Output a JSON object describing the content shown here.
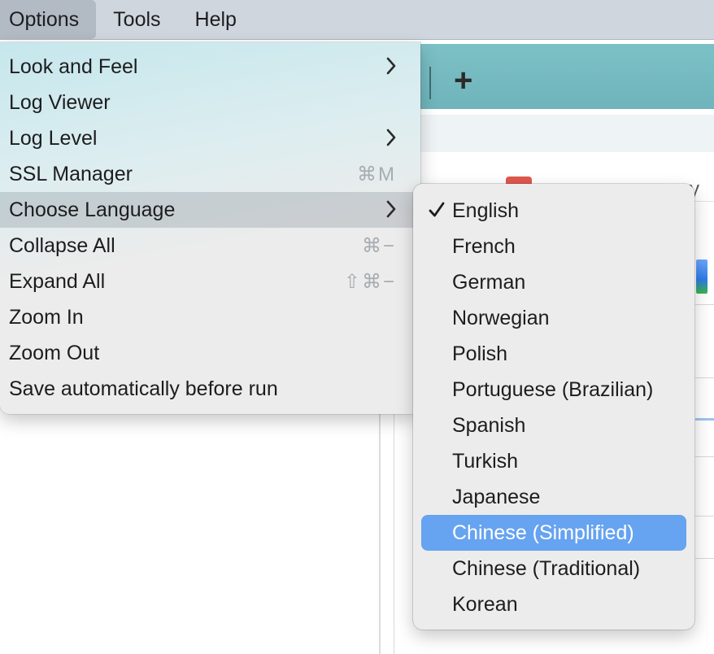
{
  "menubar": {
    "items": [
      {
        "label": "Options",
        "active": true
      },
      {
        "label": "Tools",
        "active": false
      },
      {
        "label": "Help",
        "active": false
      }
    ]
  },
  "background": {
    "toolbar_add_label": "+",
    "tab_fragment": "ry"
  },
  "options_menu": {
    "items": [
      {
        "label": "Look and Feel",
        "submenu": true,
        "shortcut": ""
      },
      {
        "label": "Log Viewer",
        "submenu": false,
        "shortcut": ""
      },
      {
        "label": "Log Level",
        "submenu": true,
        "shortcut": ""
      },
      {
        "label": "SSL Manager",
        "submenu": false,
        "shortcut": "⌘M"
      },
      {
        "label": "Choose Language",
        "submenu": true,
        "shortcut": "",
        "highlighted": true
      },
      {
        "label": "Collapse All",
        "submenu": false,
        "shortcut": "⌘−"
      },
      {
        "label": "Expand All",
        "submenu": false,
        "shortcut": "⇧⌘−"
      },
      {
        "label": "Zoom In",
        "submenu": false,
        "shortcut": ""
      },
      {
        "label": "Zoom Out",
        "submenu": false,
        "shortcut": ""
      },
      {
        "label": "Save automatically before run",
        "submenu": false,
        "shortcut": ""
      }
    ]
  },
  "language_menu": {
    "checked": "English",
    "hovered": "Chinese (Simplified)",
    "items": [
      {
        "label": "English"
      },
      {
        "label": "French"
      },
      {
        "label": "German"
      },
      {
        "label": "Norwegian"
      },
      {
        "label": "Polish"
      },
      {
        "label": "Portuguese (Brazilian)"
      },
      {
        "label": "Spanish"
      },
      {
        "label": "Turkish"
      },
      {
        "label": "Japanese"
      },
      {
        "label": "Chinese (Simplified)"
      },
      {
        "label": "Chinese (Traditional)"
      },
      {
        "label": "Korean"
      }
    ]
  },
  "colors": {
    "selection_blue": "#66a3f0",
    "menubar_bg": "#cfd6de",
    "toolbar_teal": "#72b8be"
  }
}
